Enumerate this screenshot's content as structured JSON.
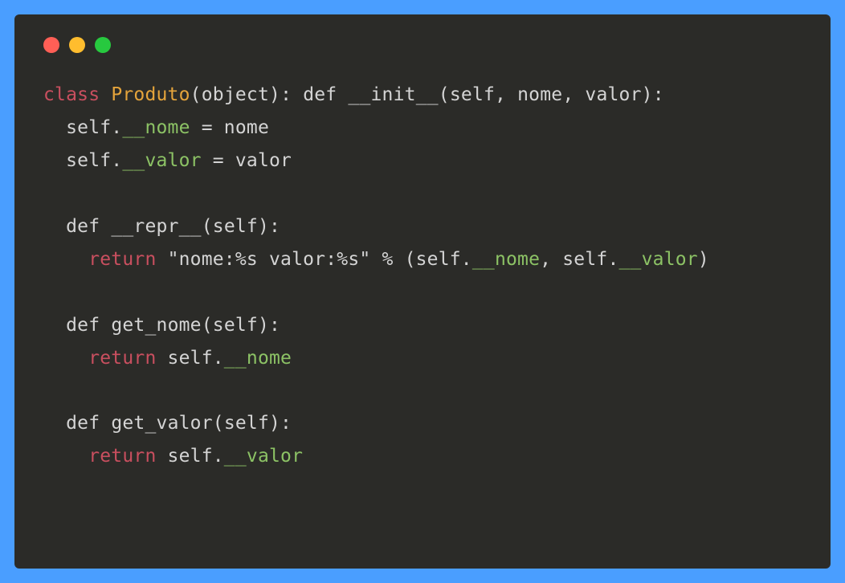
{
  "titlebar": {
    "close_color": "#ff5f56",
    "minimize_color": "#ffbd2e",
    "zoom_color": "#27c93f"
  },
  "code": {
    "line1": {
      "kw_class": "class",
      "cls_name": "Produto",
      "paren_open": "(",
      "base": "object",
      "paren_close_colon": "):",
      "kw_def": "def",
      "fn_init": "__init__",
      "params": "(self, nome, valor):"
    },
    "line2": {
      "indent": "  ",
      "self_dot": "self.",
      "attr": "__nome",
      "assign": " = nome"
    },
    "line3": {
      "indent": "  ",
      "self_dot": "self.",
      "attr": "__valor",
      "assign": " = valor"
    },
    "line5": {
      "indent": "  ",
      "kw_def": "def",
      "fn": "__repr__",
      "params": "(self):"
    },
    "line6": {
      "indent": "    ",
      "kw_return": "return",
      "str": "\"nome:%s valor:%s\"",
      "pct": " % (self.",
      "attr1": "__nome",
      "mid": ", self.",
      "attr2": "__valor",
      "end": ")"
    },
    "line8": {
      "indent": "  ",
      "kw_def": "def",
      "fn": "get_nome",
      "params": "(self):"
    },
    "line9": {
      "indent": "    ",
      "kw_return": "return",
      "self_dot": " self.",
      "attr": "__nome"
    },
    "line11": {
      "indent": "  ",
      "kw_def": "def",
      "fn": "get_valor",
      "params": "(self):"
    },
    "line12": {
      "indent": "    ",
      "kw_return": "return",
      "self_dot": " self.",
      "attr": "__valor"
    }
  }
}
